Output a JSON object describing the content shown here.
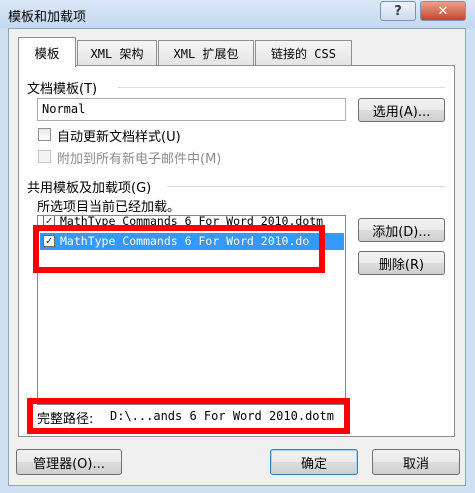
{
  "window": {
    "title": "模板和加载项",
    "help_label": "?",
    "close_label": "✕"
  },
  "tabs": [
    {
      "label": "模板",
      "active": true
    },
    {
      "label": "XML 架构",
      "active": false
    },
    {
      "label": "XML 扩展包",
      "active": false
    },
    {
      "label": "链接的 CSS",
      "active": false
    }
  ],
  "document_template": {
    "label": "文档模板(T)",
    "value": "Normal",
    "choose_button": "选用(A)...",
    "auto_update_label": "自动更新文档样式(U)",
    "auto_update_checked": false,
    "attach_email_label": "附加到所有新电子邮件中(M)",
    "attach_email_enabled": false
  },
  "global_templates": {
    "label": "共用模板及加载项(G)",
    "sublabel": "所选项目当前已经加载。",
    "items": [
      {
        "text": "MathType Commands 6 For Word 2010.dotm",
        "checked": true,
        "selected": false
      },
      {
        "text": "MathType Commands 6 For Word 2010.do",
        "checked": true,
        "selected": true
      }
    ],
    "add_button": "添加(D)...",
    "remove_button": "删除(R)",
    "full_path_label": "完整路径:",
    "full_path_value": "D:\\...ands 6 For Word 2010.dotm"
  },
  "footer": {
    "organizer_button": "管理器(O)...",
    "ok_button": "确定",
    "cancel_button": "取消"
  },
  "highlight_color": "#ff0000"
}
